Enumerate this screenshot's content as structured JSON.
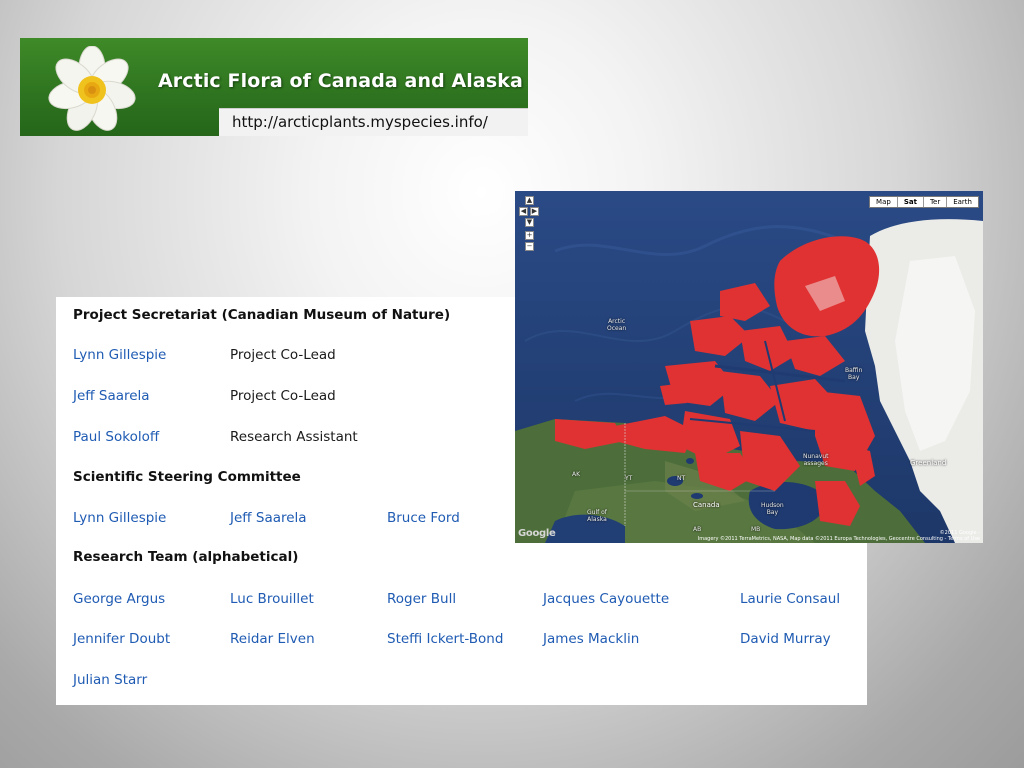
{
  "banner": {
    "title": "Arctic Flora of Canada and Alaska",
    "url": "http://arcticplants.myspecies.info/"
  },
  "team": {
    "secretariat": {
      "heading": "Project Secretariat (Canadian Museum of Nature)",
      "rows": [
        {
          "name": "Lynn Gillespie",
          "role": "Project Co-Lead"
        },
        {
          "name": "Jeff Saarela",
          "role": "Project Co-Lead"
        },
        {
          "name": "Paul Sokoloff",
          "role": "Research Assistant"
        }
      ]
    },
    "steering": {
      "heading": "Scientific Steering Committee",
      "members": [
        "Lynn Gillespie",
        "Jeff Saarela",
        "Bruce Ford"
      ]
    },
    "research": {
      "heading": "Research Team (alphabetical)",
      "members": [
        "George Argus",
        "Luc Brouillet",
        "Roger Bull",
        "Jacques Cayouette",
        "Laurie Consaul",
        "Jennifer Doubt",
        "Reidar Elven",
        "Steffi Ickert-Bond",
        "James Macklin",
        "David Murray",
        "Julian Starr"
      ]
    }
  },
  "map": {
    "types": [
      "Map",
      "Sat",
      "Ter",
      "Earth"
    ],
    "active_type": "Sat",
    "labels": {
      "arctic_ocean": "Arctic\nOcean",
      "baffin_bay": "Baffin\nBay",
      "greenland": "Greenland",
      "nunavut": "Nunavut\nassages",
      "hudson_bay": "Hudson\nBay",
      "ak": "AK",
      "yt": "YT",
      "nt": "NT",
      "canada": "Canada",
      "ab": "AB",
      "mb": "MB",
      "gulf_alaska": "Gulf of\nAlaska"
    },
    "logo": "Google",
    "attribution_line1": "©2011 Google -",
    "attribution_line2": "Imagery ©2011 TerraMetrics, NASA, Map data ©2011 Europa Technologies, Geocentre Consulting - Terms of Use",
    "colors": {
      "ocean": "#203d73",
      "highlight": "#e03232",
      "land": "#4d6e3a",
      "ice": "#ebebe8"
    }
  }
}
